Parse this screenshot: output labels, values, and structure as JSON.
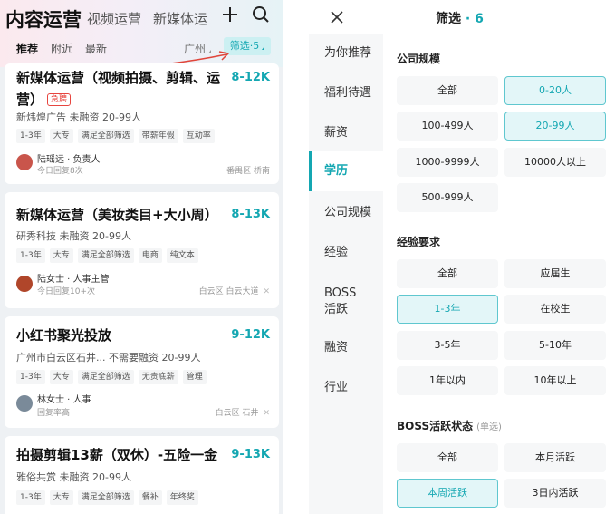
{
  "left": {
    "tabs": [
      "内容运营",
      "视频运营",
      "新媒体运"
    ],
    "subtabs": [
      "推荐",
      "附近",
      "最新"
    ],
    "city": "广州",
    "filter_chip": "筛选·5",
    "jobs": [
      {
        "title": "新媒体运营（视频拍摄、剪辑、运营）",
        "badge": "急聘",
        "salary": "8-12K",
        "company": "新炜煌广告 未融资 20-99人",
        "tags": [
          "1-3年",
          "大专",
          "满足全部筛选",
          "带薪年假",
          "互动率"
        ],
        "recruiter": "陆瑶远 · 负责人",
        "reply": "今日回复8次",
        "location": "番禺区 桥南",
        "avatar_color": "#c9554b"
      },
      {
        "title": "新媒体运营（美妆类目+大小周）",
        "badge": "",
        "salary": "8-13K",
        "company": "研秀科技 未融资 20-99人",
        "tags": [
          "1-3年",
          "大专",
          "满足全部筛选",
          "电商",
          "纯文本"
        ],
        "recruiter": "陆女士 · 人事主管",
        "reply": "今日回复10+次",
        "location": "白云区 白云大道",
        "avatar_color": "#b0462a"
      },
      {
        "title": "小红书聚光投放",
        "badge": "",
        "salary": "9-12K",
        "company": "广州市白云区石井... 不需要融资 20-99人",
        "tags": [
          "1-3年",
          "大专",
          "满足全部筛选",
          "无责底薪",
          "管理"
        ],
        "recruiter": "林女士 · 人事",
        "reply": "回复率高",
        "location": "白云区 石井",
        "avatar_color": "#7a8a99"
      },
      {
        "title": "拍摄剪辑13薪（双休）-五险一金",
        "badge": "",
        "salary": "9-13K",
        "company": "雅俗共赏 未融资 20-99人",
        "tags": [
          "1-3年",
          "大专",
          "满足全部筛选",
          "餐补",
          "年终奖"
        ],
        "recruiter": "",
        "reply": "",
        "location": "",
        "avatar_color": "#999999"
      }
    ]
  },
  "right": {
    "title": "筛选",
    "count_text": "· 6",
    "nav": [
      "为你推荐",
      "福利待遇",
      "薪资",
      "学历",
      "公司规模",
      "经验",
      "BOSS\n活跃",
      "融资",
      "行业"
    ],
    "active_nav_index": 3,
    "sections": [
      {
        "title": "公司规模",
        "hint": "",
        "options": [
          "全部",
          "0-20人",
          "100-499人",
          "20-99人",
          "1000-9999人",
          "10000人以上",
          "500-999人"
        ],
        "selected": [
          1,
          3
        ]
      },
      {
        "title": "经验要求",
        "hint": "",
        "options": [
          "全部",
          "应届生",
          "1-3年",
          "在校生",
          "3-5年",
          "5-10年",
          "1年以内",
          "10年以上"
        ],
        "selected": [
          2
        ]
      },
      {
        "title": "BOSS活跃状态",
        "hint": "(单选)",
        "options": [
          "全部",
          "本月活跃",
          "本周活跃",
          "3日内活跃"
        ],
        "selected": [
          2
        ]
      }
    ]
  },
  "colors": {
    "accent": "#14a7b2",
    "urgent": "#e7453f",
    "annotation_arrow": "#e0453a"
  },
  "icons": [
    "plus-icon",
    "search-icon",
    "close-icon",
    "dropdown-triangle-icon"
  ]
}
